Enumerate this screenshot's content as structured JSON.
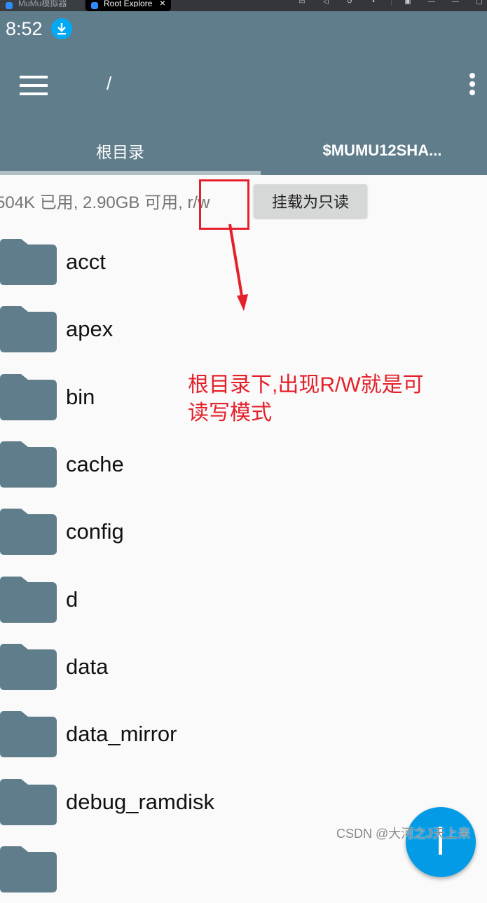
{
  "host_window": {
    "tabs": [
      {
        "label": "MuMu模拟器",
        "active": false
      },
      {
        "label": "Root Explorer",
        "active": true
      }
    ]
  },
  "status_bar": {
    "time": "8:52",
    "notification_icon": "download-icon"
  },
  "app_bar": {
    "menu_icon": "hamburger-menu-icon",
    "title": "/",
    "overflow_icon": "more-vert-icon"
  },
  "tabs": [
    {
      "label": "根目录",
      "active": true
    },
    {
      "label": "$MUMU12SHA...",
      "active": false
    }
  ],
  "storage": {
    "info": "504K 已用, 2.90GB 可用, r/w",
    "mount_button": "挂载为只读"
  },
  "annotation": {
    "text": "根目录下,出现R/W就是可读写模式",
    "color": "#e4202a"
  },
  "files": [
    {
      "name": "acct",
      "type": "folder"
    },
    {
      "name": "apex",
      "type": "folder"
    },
    {
      "name": "bin",
      "type": "folder"
    },
    {
      "name": "cache",
      "type": "folder"
    },
    {
      "name": "config",
      "type": "folder"
    },
    {
      "name": "d",
      "type": "folder"
    },
    {
      "name": "data",
      "type": "folder"
    },
    {
      "name": "data_mirror",
      "type": "folder"
    },
    {
      "name": "debug_ramdisk",
      "type": "folder"
    }
  ],
  "watermark": "CSDN @大河之J天上来",
  "colors": {
    "primary": "#607d8b",
    "fab": "#039be5",
    "folder": "#607d8b"
  }
}
